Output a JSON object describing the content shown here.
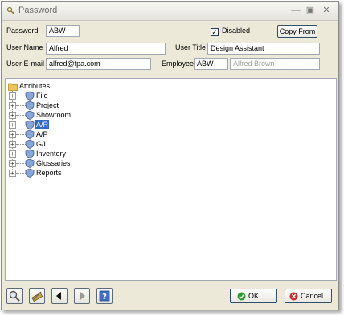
{
  "window": {
    "title": "Password"
  },
  "form": {
    "password_label": "Password",
    "password_value": "ABW",
    "disabled_label": "Disabled",
    "disabled_checked": true,
    "copy_from_label": "Copy From",
    "user_name_label": "User Name",
    "user_name_value": "Alfred",
    "user_title_label": "User Title",
    "user_title_value": "Design Assistant",
    "user_email_label": "User E-mail",
    "user_email_value": "alfred@fpa.com",
    "employee_label": "Employee",
    "employee_code": "ABW",
    "employee_name": "Alfred Brown"
  },
  "tree": {
    "root_label": "Attributes",
    "items": [
      {
        "label": "File",
        "selected": false
      },
      {
        "label": "Project",
        "selected": false
      },
      {
        "label": "Showroom",
        "selected": false
      },
      {
        "label": "A/R",
        "selected": true
      },
      {
        "label": "A/P",
        "selected": false
      },
      {
        "label": "G/L",
        "selected": false
      },
      {
        "label": "Inventory",
        "selected": false
      },
      {
        "label": "Glossaries",
        "selected": false
      },
      {
        "label": "Reports",
        "selected": false
      }
    ]
  },
  "footer": {
    "ok_label": "OK",
    "cancel_label": "Cancel"
  },
  "icons": {
    "search": "magnifier-icon",
    "tools": "tools-icon",
    "prev": "arrow-left-icon",
    "next": "arrow-right-icon",
    "help": "help-icon",
    "ok": "check-circle-icon",
    "cancel": "x-circle-icon"
  },
  "colors": {
    "selection": "#316ac5",
    "window_bg": "#ece9d8",
    "ok_green": "#2e9b2e",
    "cancel_red": "#cc2a2a"
  }
}
